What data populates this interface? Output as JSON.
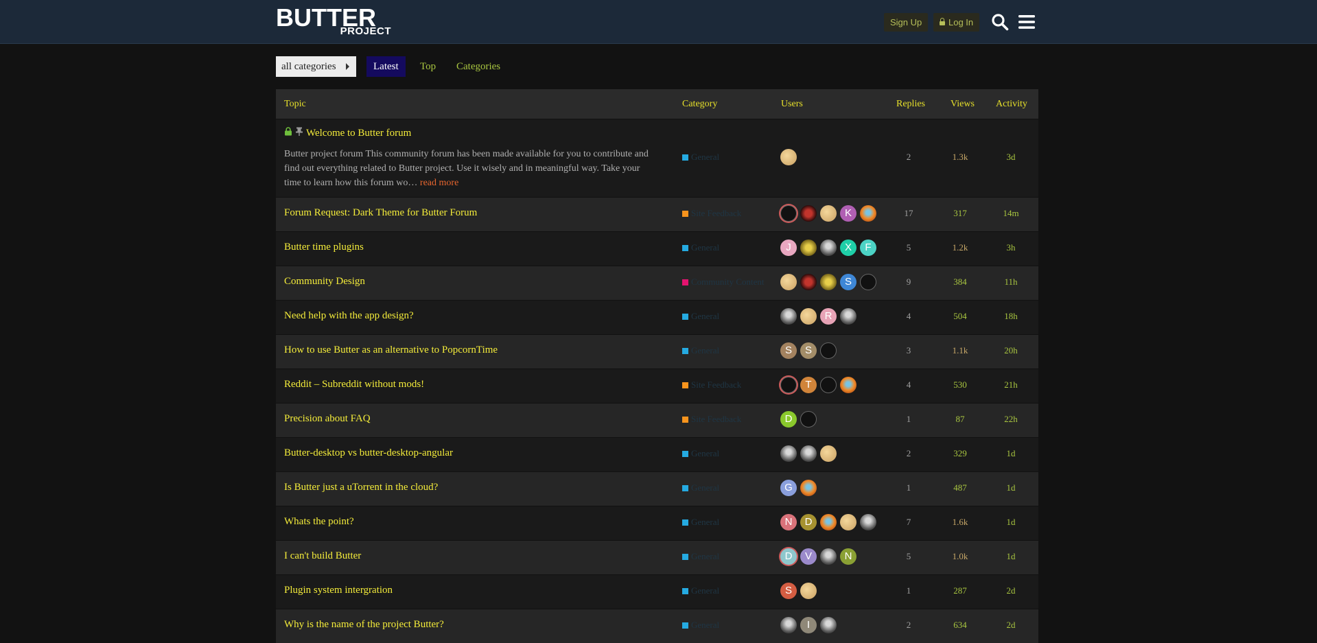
{
  "header": {
    "logo_main": "BUTTER",
    "logo_sub": "PROJECT",
    "signup_label": "Sign Up",
    "login_label": "Log In"
  },
  "nav": {
    "category_dropdown": "all categories",
    "tabs": [
      "Latest",
      "Top",
      "Categories"
    ],
    "active_tab": "Latest"
  },
  "table": {
    "columns": [
      "Topic",
      "Category",
      "Users",
      "Replies",
      "Views",
      "Activity"
    ],
    "rows": [
      {
        "title": "Welcome to Butter forum",
        "pinned": true,
        "locked": true,
        "excerpt": "Butter project forum This community forum has been made available for you to contribute and find out everything related to Butter project. Use it wisely and in meaningful way. Take your time to learn how this forum wo…",
        "read_more": "read more",
        "category": "General",
        "category_color": "#25aae1",
        "avatars": [
          {
            "type": "box"
          }
        ],
        "replies": "2",
        "views": "1.3k",
        "views_hot": true,
        "activity": "3d"
      },
      {
        "title": "Forum Request: Dark Theme for Butter Forum",
        "category": "Site Feedback",
        "category_color": "#f7941d",
        "avatars": [
          {
            "type": "dark",
            "ring": true
          },
          {
            "type": "red"
          },
          {
            "type": "box"
          },
          {
            "letter": "K",
            "color": "#b05fb3"
          },
          {
            "type": "orange"
          }
        ],
        "replies": "17",
        "views": "317",
        "views_hot": false,
        "activity": "14m"
      },
      {
        "title": "Butter time plugins",
        "category": "General",
        "category_color": "#25aae1",
        "avatars": [
          {
            "letter": "J",
            "color": "#e8a7c0"
          },
          {
            "type": "gold"
          },
          {
            "type": "grey"
          },
          {
            "letter": "X",
            "color": "#1fcfa8"
          },
          {
            "letter": "F",
            "color": "#4cd3c5"
          }
        ],
        "replies": "5",
        "views": "1.2k",
        "views_hot": true,
        "activity": "3h"
      },
      {
        "title": "Community Design",
        "category": "Community Content",
        "category_color": "#e4136f",
        "avatars": [
          {
            "type": "box"
          },
          {
            "type": "red"
          },
          {
            "type": "gold"
          },
          {
            "letter": "S",
            "color": "#3e87d6"
          },
          {
            "type": "dark"
          }
        ],
        "replies": "9",
        "views": "384",
        "views_hot": false,
        "activity": "11h"
      },
      {
        "title": "Need help with the app design?",
        "category": "General",
        "category_color": "#25aae1",
        "avatars": [
          {
            "type": "grey"
          },
          {
            "type": "box"
          },
          {
            "letter": "R",
            "color": "#e7a3b6"
          },
          {
            "type": "grey"
          }
        ],
        "replies": "4",
        "views": "504",
        "views_hot": false,
        "activity": "18h"
      },
      {
        "title": "How to use Butter as an alternative to PopcornTime",
        "category": "General",
        "category_color": "#25aae1",
        "avatars": [
          {
            "letter": "S",
            "color": "#a3825f"
          },
          {
            "letter": "S",
            "color": "#a38d68"
          },
          {
            "type": "dark"
          }
        ],
        "replies": "3",
        "views": "1.1k",
        "views_hot": true,
        "activity": "20h"
      },
      {
        "title": "Reddit – Subreddit without mods!",
        "category": "Site Feedback",
        "category_color": "#f7941d",
        "avatars": [
          {
            "type": "dark",
            "ring": true
          },
          {
            "letter": "T",
            "color": "#d0843a"
          },
          {
            "type": "dark"
          },
          {
            "type": "orange"
          }
        ],
        "replies": "4",
        "views": "530",
        "views_hot": false,
        "activity": "21h"
      },
      {
        "title": "Precision about FAQ",
        "category": "Site Feedback",
        "category_color": "#f7941d",
        "avatars": [
          {
            "letter": "D",
            "color": "#8ac82c"
          },
          {
            "type": "dark"
          }
        ],
        "replies": "1",
        "views": "87",
        "views_hot": false,
        "activity": "22h"
      },
      {
        "title": "Butter-desktop vs butter-desktop-angular",
        "category": "General",
        "category_color": "#25aae1",
        "avatars": [
          {
            "type": "grey"
          },
          {
            "type": "grey"
          },
          {
            "type": "box"
          }
        ],
        "replies": "2",
        "views": "329",
        "views_hot": false,
        "activity": "1d"
      },
      {
        "title": "Is Butter just a uTorrent in the cloud?",
        "category": "General",
        "category_color": "#25aae1",
        "avatars": [
          {
            "letter": "G",
            "color": "#8a9fdc"
          },
          {
            "type": "orange"
          }
        ],
        "replies": "1",
        "views": "487",
        "views_hot": false,
        "activity": "1d"
      },
      {
        "title": "Whats the point?",
        "category": "General",
        "category_color": "#25aae1",
        "avatars": [
          {
            "letter": "N",
            "color": "#d9727a"
          },
          {
            "letter": "D",
            "color": "#a69230"
          },
          {
            "type": "orange"
          },
          {
            "type": "box"
          },
          {
            "type": "grey"
          }
        ],
        "replies": "7",
        "views": "1.6k",
        "views_hot": true,
        "activity": "1d"
      },
      {
        "title": "I can't build Butter",
        "category": "General",
        "category_color": "#25aae1",
        "avatars": [
          {
            "letter": "D",
            "color": "#8ec7cc",
            "ring": true
          },
          {
            "letter": "V",
            "color": "#9b8acb"
          },
          {
            "type": "grey"
          },
          {
            "letter": "N",
            "color": "#8aa034"
          }
        ],
        "replies": "5",
        "views": "1.0k",
        "views_hot": true,
        "activity": "1d"
      },
      {
        "title": "Plugin system intergration",
        "category": "General",
        "category_color": "#25aae1",
        "avatars": [
          {
            "letter": "S",
            "color": "#d45d42"
          },
          {
            "type": "box"
          }
        ],
        "replies": "1",
        "views": "287",
        "views_hot": false,
        "activity": "2d"
      },
      {
        "title": "Why is the name of the project Butter?",
        "category": "General",
        "category_color": "#25aae1",
        "avatars": [
          {
            "type": "grey"
          },
          {
            "letter": "I",
            "color": "#8f8878"
          },
          {
            "type": "grey"
          }
        ],
        "replies": "2",
        "views": "634",
        "views_hot": false,
        "activity": "2d"
      }
    ]
  }
}
